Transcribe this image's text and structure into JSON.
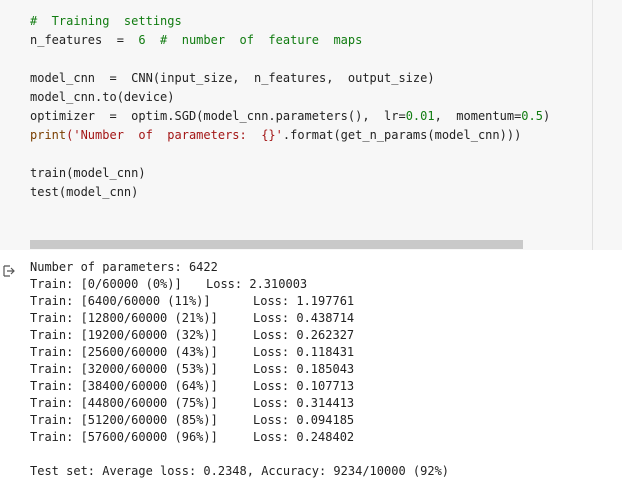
{
  "code": {
    "line1_comment": "#  Training  settings",
    "line2_var": "n_features  =  ",
    "line2_num": "6",
    "line2_comment": "  #  number  of  feature  maps",
    "line3": "",
    "line4": "model_cnn  =  CNN(input_size,  n_features,  output_size)",
    "line5": "model_cnn.to(device)",
    "line6_a": "optimizer  =  optim.SGD(model_cnn.parameters(),  lr=",
    "line6_lr": "0.01",
    "line6_b": ",  momentum=",
    "line6_m": "0.5",
    "line6_c": ")",
    "line7_print": "print",
    "line7_str": "('Number  of  parameters:  {}'",
    "line7_rest": ".format(get_n_params(model_cnn)))",
    "line8": "",
    "line9": "train(model_cnn)",
    "line10": "test(model_cnn)"
  },
  "output": {
    "params_line": "Number of parameters: 6422",
    "train_rows": [
      {
        "prefix": "Train: [0/60000 (0%)]",
        "loss": "Loss: 2.310003"
      },
      {
        "prefix": "Train: [6400/60000 (11%)]",
        "loss": "Loss: 1.197761"
      },
      {
        "prefix": "Train: [12800/60000 (21%)]",
        "loss": "Loss: 0.438714"
      },
      {
        "prefix": "Train: [19200/60000 (32%)]",
        "loss": "Loss: 0.262327"
      },
      {
        "prefix": "Train: [25600/60000 (43%)]",
        "loss": "Loss: 0.118431"
      },
      {
        "prefix": "Train: [32000/60000 (53%)]",
        "loss": "Loss: 0.185043"
      },
      {
        "prefix": "Train: [38400/60000 (64%)]",
        "loss": "Loss: 0.107713"
      },
      {
        "prefix": "Train: [44800/60000 (75%)]",
        "loss": "Loss: 0.314413"
      },
      {
        "prefix": "Train: [51200/60000 (85%)]",
        "loss": "Loss: 0.094185"
      },
      {
        "prefix": "Train: [57600/60000 (96%)]",
        "loss": "Loss: 0.248402"
      }
    ],
    "test_line": "Test set: Average loss: 0.2348, Accuracy: 9234/10000 (92%)"
  },
  "icons": {
    "output_icon": "output-arrow-icon"
  },
  "colors": {
    "comment": "#117c11",
    "string": "#a31515",
    "code_bg": "#f7f7f7",
    "scrollbar": "#c9c9c9"
  }
}
